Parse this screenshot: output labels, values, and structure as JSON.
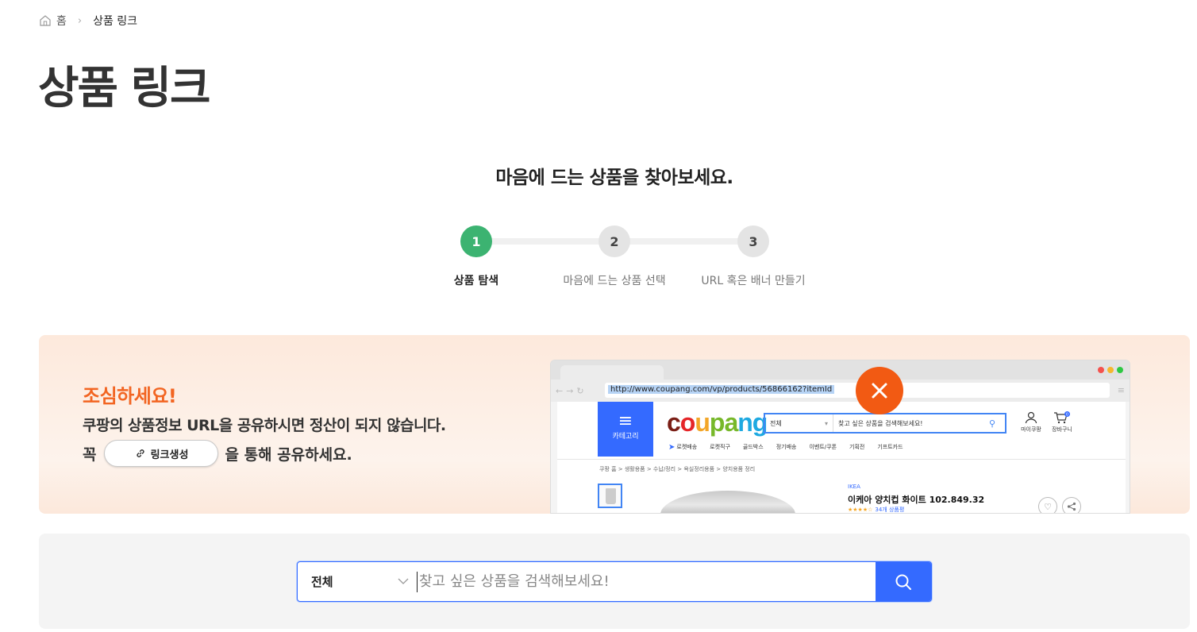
{
  "breadcrumb": {
    "home": "홈",
    "current": "상품 링크"
  },
  "page_title": "상품 링크",
  "subheading": "마음에 드는 상품을 찾아보세요.",
  "steps": [
    {
      "number": "1",
      "label": "상품 탐색",
      "active": true
    },
    {
      "number": "2",
      "label": "마음에 드는 상품 선택",
      "active": false
    },
    {
      "number": "3",
      "label": "URL 혹은 배너 만들기",
      "active": false
    }
  ],
  "warning": {
    "title": "조심하세요!",
    "description": "쿠팡의 상품정보 URL을 공유하시면 정산이 되지 않습니다.",
    "line2_prefix": "꼭",
    "button_label": "링크생성",
    "line2_suffix": "을 통해 공유하세요."
  },
  "mock_browser": {
    "url": "http://www.coupang.com/vp/products/56866162?itemId",
    "category_label": "카테고리",
    "logo": [
      "c",
      "o",
      "u",
      "p",
      "a",
      "n",
      "g"
    ],
    "search_select": "전체",
    "search_placeholder": "찾고 싶은 상품을 검색해보세요!",
    "my_label": "마이쿠팡",
    "cart_label": "장바구니",
    "cart_count": "0",
    "nav_items": [
      "로켓배송",
      "로켓직구",
      "골드박스",
      "정기배송",
      "이벤트/쿠폰",
      "기획전",
      "기프트카드"
    ],
    "crumbs": "쿠팡 홈  >  생활용품  >  수납/정리  >  욕실정리용품  >  양치용품 정리",
    "brand": "IKEA",
    "product_name": "이케아 양치컵 화이트 102.849.32",
    "rating_text": "34개 상품평"
  },
  "search": {
    "category": "전체",
    "placeholder": "찾고 싶은 상품을 검색해보세요!"
  },
  "colors": {
    "accent_blue": "#346aff",
    "step_active": "#3cb371",
    "warning_orange": "#f26522",
    "x_orange": "#f25a13"
  }
}
